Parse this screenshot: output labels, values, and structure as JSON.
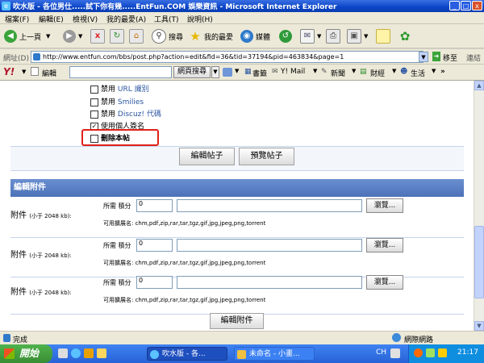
{
  "window": {
    "title": "吹水版 - 各位男仕.....試下你有幾.....EntFun.COM 娛樂資訊 - Microsoft Internet Explorer",
    "min": "_",
    "max": "□",
    "close": "x"
  },
  "menu": [
    "檔案(F)",
    "編輯(E)",
    "檢視(V)",
    "我的最愛(A)",
    "工具(T)",
    "說明(H)"
  ],
  "toolbar": {
    "back": "上一頁",
    "search": "搜尋",
    "favorites": "我的最愛",
    "media": "媒體"
  },
  "address": {
    "label": "網址(D)",
    "url": "http://www.entfun.com/bbs/post.php?action=edit&fid=36&tid=37194&pid=463834&page=1",
    "go": "移至",
    "links": "連結"
  },
  "yahoo": {
    "logo": "Y!",
    "edit": "編輯",
    "search_button": "網頁搜尋",
    "bookmarks": "書籤",
    "mail": "Y! Mail",
    "news": "新聞",
    "finance": "財經",
    "life": "生活"
  },
  "options": {
    "disable_url": {
      "prefix": "禁用",
      "name": "URL 識別",
      "checked": false
    },
    "disable_smilies": {
      "prefix": "禁用",
      "name": "Smilies",
      "checked": false
    },
    "disable_discuz": {
      "prefix": "禁用",
      "name": "Discuz! 代碼",
      "checked": false
    },
    "use_signature": {
      "label": "使用個人簽名",
      "checked": true
    },
    "delete_post": {
      "label": "刪除本帖",
      "checked": false
    }
  },
  "buttons": {
    "edit_post": "編輯帖子",
    "preview_post": "預覽帖子",
    "edit_attach": "編輯附件"
  },
  "attachments": {
    "header": "編輯附件",
    "rows": [
      {
        "label": "附件",
        "limit": "(小于 2048 kb):",
        "needs": "所需 積分",
        "points": "0",
        "browse": "瀏覽...",
        "exts": "可用擴展名: chm,pdf,zip,rar,tar,tgz,gif,jpg,jpeg,png,torrent"
      },
      {
        "label": "附件",
        "limit": "(小于 2048 kb):",
        "needs": "所需 積分",
        "points": "0",
        "browse": "瀏覽...",
        "exts": "可用擴展名: chm,pdf,zip,rar,tar,tgz,gif,jpg,jpeg,png,torrent"
      },
      {
        "label": "附件",
        "limit": "(小于 2048 kb):",
        "needs": "所需 積分",
        "points": "0",
        "browse": "瀏覽...",
        "exts": "可用擴展名: chm,pdf,zip,rar,tar,tgz,gif,jpg,jpeg,png,torrent"
      }
    ]
  },
  "status": {
    "left": "完成",
    "zone": "網際網路"
  },
  "taskbar": {
    "start": "開始",
    "task1": "吹水版 - 各...",
    "task2": "未命名 - 小畫...",
    "lang": "CH",
    "time": "21:17"
  },
  "colors": {
    "highlight": "#e0201a",
    "header_blue": "#4d72b8"
  }
}
